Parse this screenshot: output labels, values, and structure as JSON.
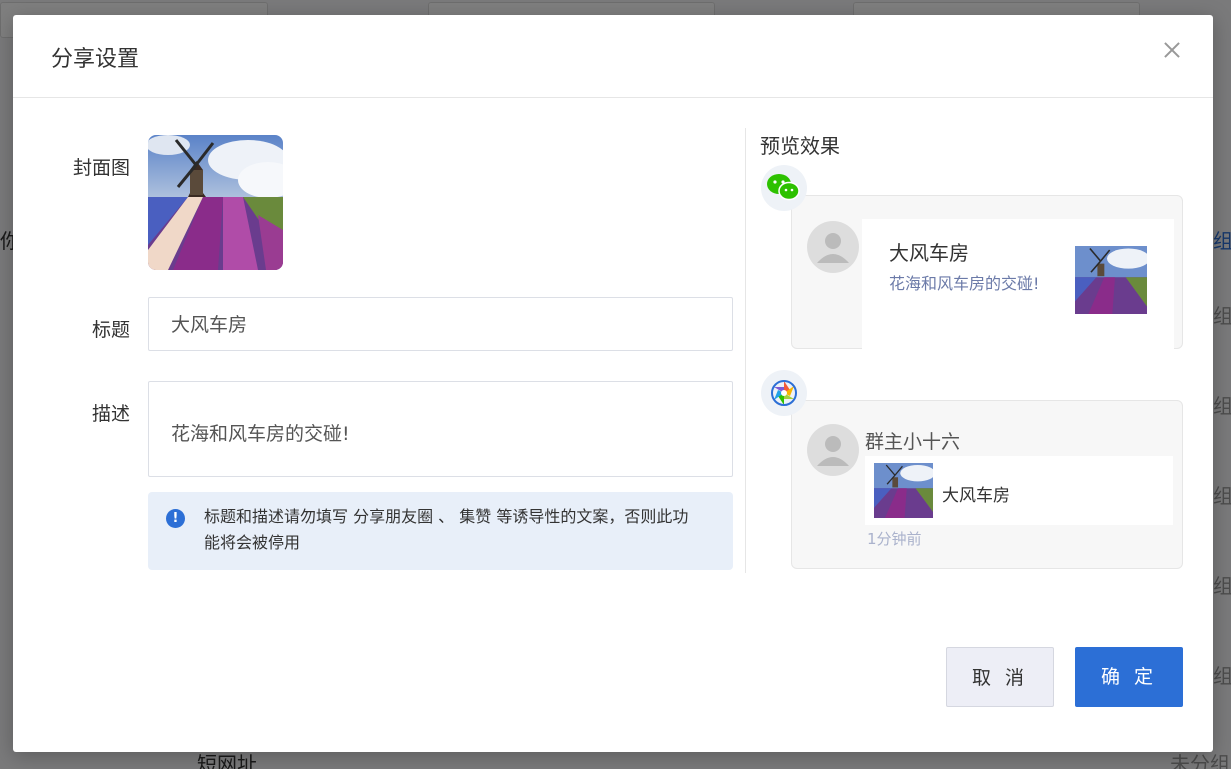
{
  "modal": {
    "title": "分享设置"
  },
  "form": {
    "cover_label": "封面图",
    "title_label": "标题",
    "title_value": "大风车房",
    "desc_label": "描述",
    "desc_value": "花海和风车房的交碰!",
    "tip_text": "标题和描述请勿填写 分享朋友圈 、 集赞 等诱导性的文案，否则此功能将会被停用"
  },
  "preview": {
    "title": "预览效果",
    "wechat_card": {
      "title": "大风车房",
      "desc": "花海和风车房的交碰!"
    },
    "moments_card": {
      "user_name": "群主小十六",
      "link_title": "大风车房",
      "time": "1分钟前"
    }
  },
  "buttons": {
    "cancel": "取 消",
    "ok": "确 定"
  },
  "background": {
    "texts": [
      "短网址",
      "未分组",
      "你",
      "组",
      "组",
      "组",
      "组",
      "组",
      "组"
    ]
  },
  "colors": {
    "primary": "#2c6fd6",
    "tip_bg": "#e8eff9",
    "wechat_green": "#2dc100"
  }
}
